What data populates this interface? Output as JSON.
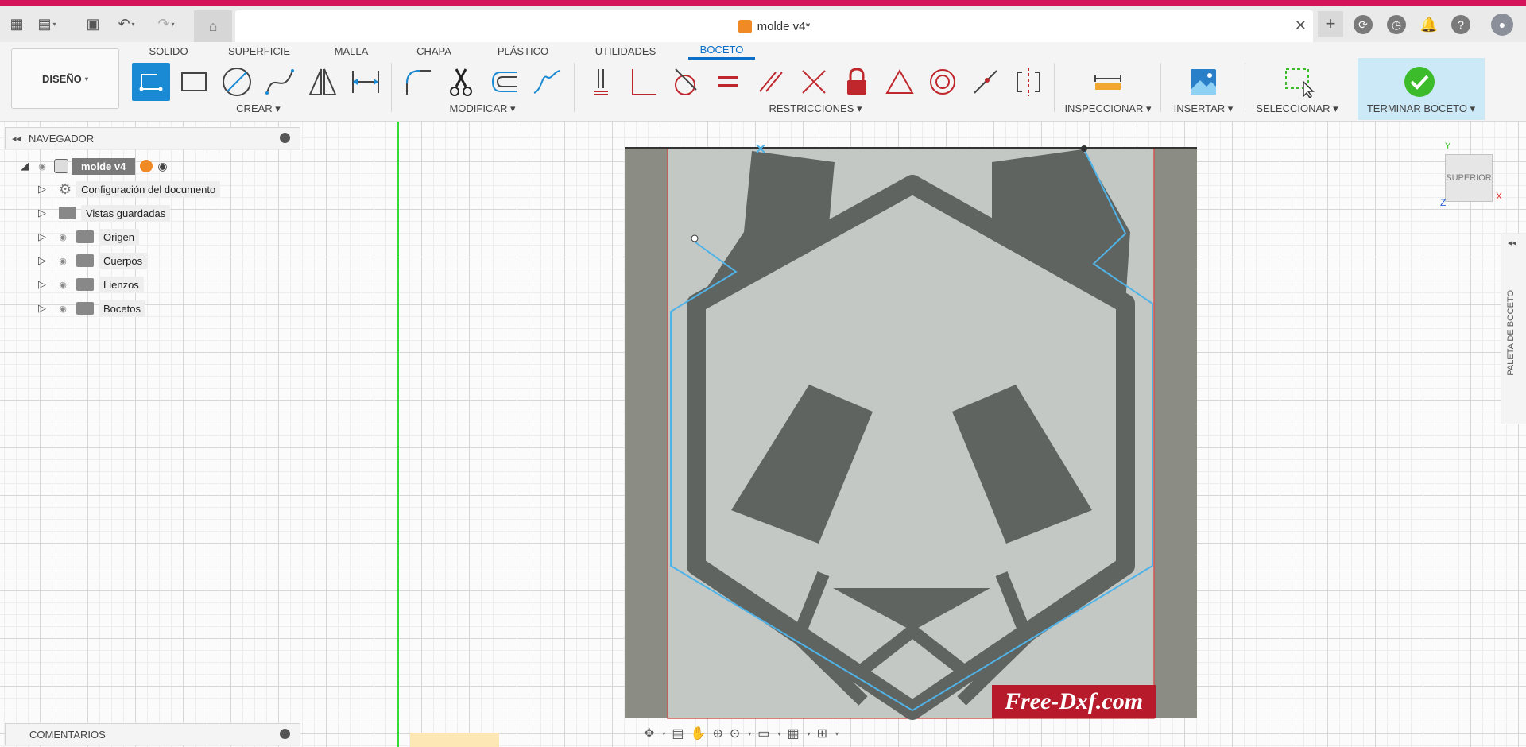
{
  "document": {
    "title": "molde v4*"
  },
  "ribbon": {
    "workspace": "DISEÑO",
    "tabs": [
      {
        "label": "SOLIDO"
      },
      {
        "label": "SUPERFICIE"
      },
      {
        "label": "MALLA"
      },
      {
        "label": "CHAPA"
      },
      {
        "label": "PLÁSTICO"
      },
      {
        "label": "UTILIDADES"
      },
      {
        "label": "BOCETO"
      }
    ],
    "active_tab": "BOCETO",
    "groups": {
      "create": "CREAR ▾",
      "modify": "MODIFICAR ▾",
      "constraints": "RESTRICCIONES ▾",
      "inspect": "INSPECCIONAR ▾",
      "insert": "INSERTAR ▾",
      "select": "SELECCIONAR ▾",
      "finish": "TERMINAR BOCETO ▾"
    }
  },
  "browser": {
    "title": "NAVEGADOR",
    "root": "molde v4",
    "items": [
      {
        "label": "Configuración del documento"
      },
      {
        "label": "Vistas guardadas"
      },
      {
        "label": "Origen"
      },
      {
        "label": "Cuerpos"
      },
      {
        "label": "Lienzos"
      },
      {
        "label": "Bocetos"
      }
    ]
  },
  "comments": {
    "title": "COMENTARIOS"
  },
  "viewcube": {
    "face": "SUPERIOR",
    "axis_x": "X",
    "axis_y": "Y",
    "axis_z": "Z"
  },
  "palette": {
    "label": "PALETA DE BOCETO"
  },
  "canvas_image": {
    "watermark": "Free-Dxf.com"
  },
  "colors": {
    "accent": "#0b6ec8",
    "brand_bar": "#d4145a",
    "sketch_line": "#4fb3e8",
    "finish_green": "#3cbc2a"
  }
}
